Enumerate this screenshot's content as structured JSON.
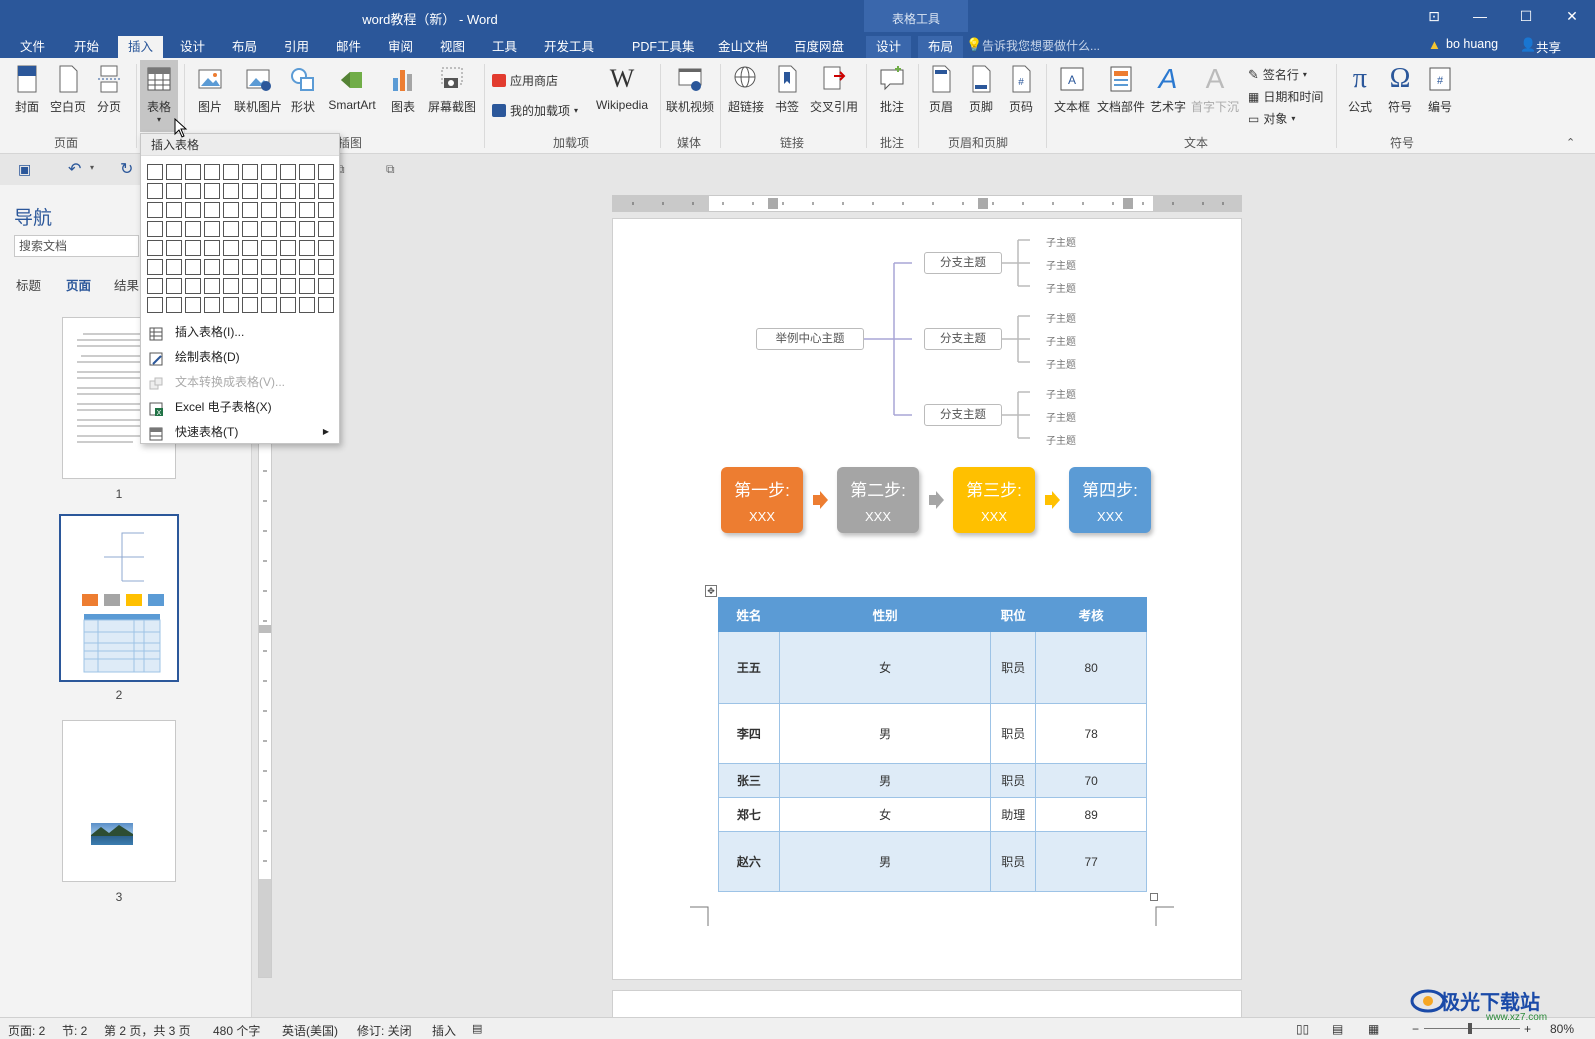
{
  "window": {
    "title": "word教程（新） - Word",
    "context_tab": "表格工具",
    "controls": [
      "⊡",
      "—",
      "☐",
      "✕"
    ]
  },
  "tabs": {
    "items": [
      "文件",
      "开始",
      "插入",
      "设计",
      "布局",
      "引用",
      "邮件",
      "审阅",
      "视图",
      "工具",
      "开发工具",
      "PDF工具集",
      "金山文档",
      "百度网盘",
      "设计",
      "布局"
    ],
    "active": "插入",
    "tell_me": "告诉我您想要做什么...",
    "user": "bo huang",
    "share": "共享"
  },
  "ribbon": {
    "pages": {
      "cover": "封面",
      "blank": "空白页",
      "break": "分页",
      "group": "页面"
    },
    "table": {
      "label": "表格",
      "group": "表格"
    },
    "illustrations": {
      "picture": "图片",
      "online_picture": "联机图片",
      "shapes": "形状",
      "smartart": "SmartArt",
      "chart": "图表",
      "screenshot": "屏幕截图",
      "group": "插图"
    },
    "addins": {
      "store": "应用商店",
      "my_addins": "我的加载项",
      "wikipedia": "Wikipedia",
      "group": "加载项"
    },
    "media": {
      "online_video": "联机视频",
      "group": "媒体"
    },
    "links": {
      "hyperlink": "超链接",
      "bookmark": "书签",
      "crossref": "交叉引用",
      "group": "链接"
    },
    "comments": {
      "comment": "批注",
      "group": "批注"
    },
    "header_footer": {
      "header": "页眉",
      "footer": "页脚",
      "page_number": "页码",
      "group": "页眉和页脚"
    },
    "text": {
      "textbox": "文本框",
      "quick_parts": "文档部件",
      "wordart": "艺术字",
      "dropcap": "首字下沉",
      "signature": "签名行",
      "datetime": "日期和时间",
      "object": "对象",
      "group": "文本"
    },
    "symbols": {
      "equation": "公式",
      "symbol": "符号",
      "number": "编号",
      "group": "符号"
    }
  },
  "table_menu": {
    "header": "插入表格",
    "grid_cols": 10,
    "grid_rows": 8,
    "items": [
      {
        "label": "插入表格(I)...",
        "disabled": false
      },
      {
        "label": "绘制表格(D)",
        "disabled": false
      },
      {
        "label": "文本转换成表格(V)...",
        "disabled": true
      },
      {
        "label": "Excel 电子表格(X)",
        "disabled": false
      },
      {
        "label": "快速表格(T)",
        "disabled": false
      }
    ]
  },
  "nav": {
    "title": "导航",
    "search_placeholder": "搜索文档",
    "tabs": [
      "标题",
      "页面",
      "结果"
    ],
    "active_tab": "页面",
    "pages": [
      "1",
      "2",
      "3"
    ],
    "selected_page": "2"
  },
  "mindmap": {
    "center": "举例中心主题",
    "branches": [
      "分支主题",
      "分支主题",
      "分支主题"
    ],
    "leaf": "子主题"
  },
  "steps": [
    {
      "title": "第一步:",
      "sub": "XXX",
      "color": "#ed7d31"
    },
    {
      "title": "第二步:",
      "sub": "XXX",
      "color": "#a5a5a5"
    },
    {
      "title": "第三步:",
      "sub": "XXX",
      "color": "#ffc000"
    },
    {
      "title": "第四步:",
      "sub": "XXX",
      "color": "#5b9bd5"
    }
  ],
  "table": {
    "headers": [
      "姓名",
      "性别",
      "职位",
      "考核"
    ],
    "rows": [
      [
        "王五",
        "女",
        "职员",
        "80"
      ],
      [
        "李四",
        "男",
        "职员",
        "78"
      ],
      [
        "张三",
        "男",
        "职员",
        "70"
      ],
      [
        "郑七",
        "女",
        "助理",
        "89"
      ],
      [
        "赵六",
        "男",
        "职员",
        "77"
      ]
    ]
  },
  "status": {
    "page": "页面: 2",
    "section": "节: 2",
    "page_of": "第 2 页，共 3 页",
    "words": "480 个字",
    "lang": "英语(美国)",
    "track": "修订: 关闭",
    "mode": "插入",
    "zoom": "80%"
  },
  "watermark": {
    "text": "极光下载站",
    "url": "www.xz7.com"
  },
  "colors": {
    "brand": "#2b579a",
    "table_header": "#5b9bd5",
    "table_band": "#deebf7"
  }
}
